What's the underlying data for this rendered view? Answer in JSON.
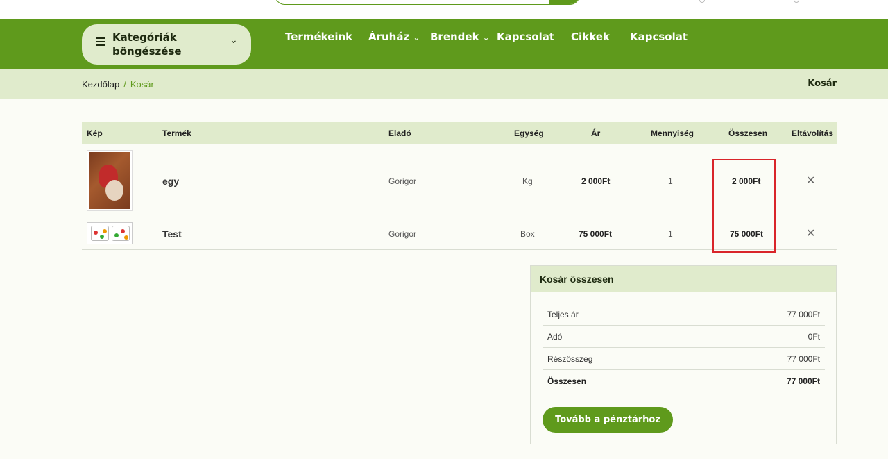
{
  "nav": {
    "categories_label": "Kategóriák böngészése",
    "items": [
      {
        "label": "Termékeink"
      },
      {
        "label": "Áruház"
      },
      {
        "label": "Brendek"
      },
      {
        "label": "Kapcsolat"
      },
      {
        "label": "Cikkek"
      },
      {
        "label": "Kapcsolat"
      }
    ]
  },
  "breadcrumb": {
    "home": "Kezdőlap",
    "separator": "/",
    "current": "Kosár",
    "title": "Kosár"
  },
  "table": {
    "headers": [
      "Kép",
      "Termék",
      "Eladó",
      "Egység",
      "Ár",
      "Mennyiség",
      "Összesen",
      "Eltávolítás"
    ],
    "rows": [
      {
        "name": "egy",
        "seller": "Gorigor",
        "unit": "Kg",
        "price": "2 000Ft",
        "qty": "1",
        "total": "2 000Ft"
      },
      {
        "name": "Test",
        "seller": "Gorigor",
        "unit": "Box",
        "price": "75 000Ft",
        "qty": "1",
        "total": "75 000Ft"
      }
    ]
  },
  "totals": {
    "title": "Kosár összesen",
    "rows": [
      {
        "label": "Teljes ár",
        "value": "77 000Ft"
      },
      {
        "label": "Adó",
        "value": "0Ft"
      },
      {
        "label": "Részösszeg",
        "value": "77 000Ft"
      },
      {
        "label": "Összesen",
        "value": "77 000Ft"
      }
    ],
    "checkout_label": "Tovább a pénztárhoz"
  },
  "icons": {
    "menu": "hamburger-icon",
    "chevron": "chevron-down-icon",
    "remove": "close-icon"
  },
  "colors": {
    "brand_green": "#5f9a1c",
    "light_green": "#e0ebcc",
    "highlight_red": "#d9252a"
  }
}
